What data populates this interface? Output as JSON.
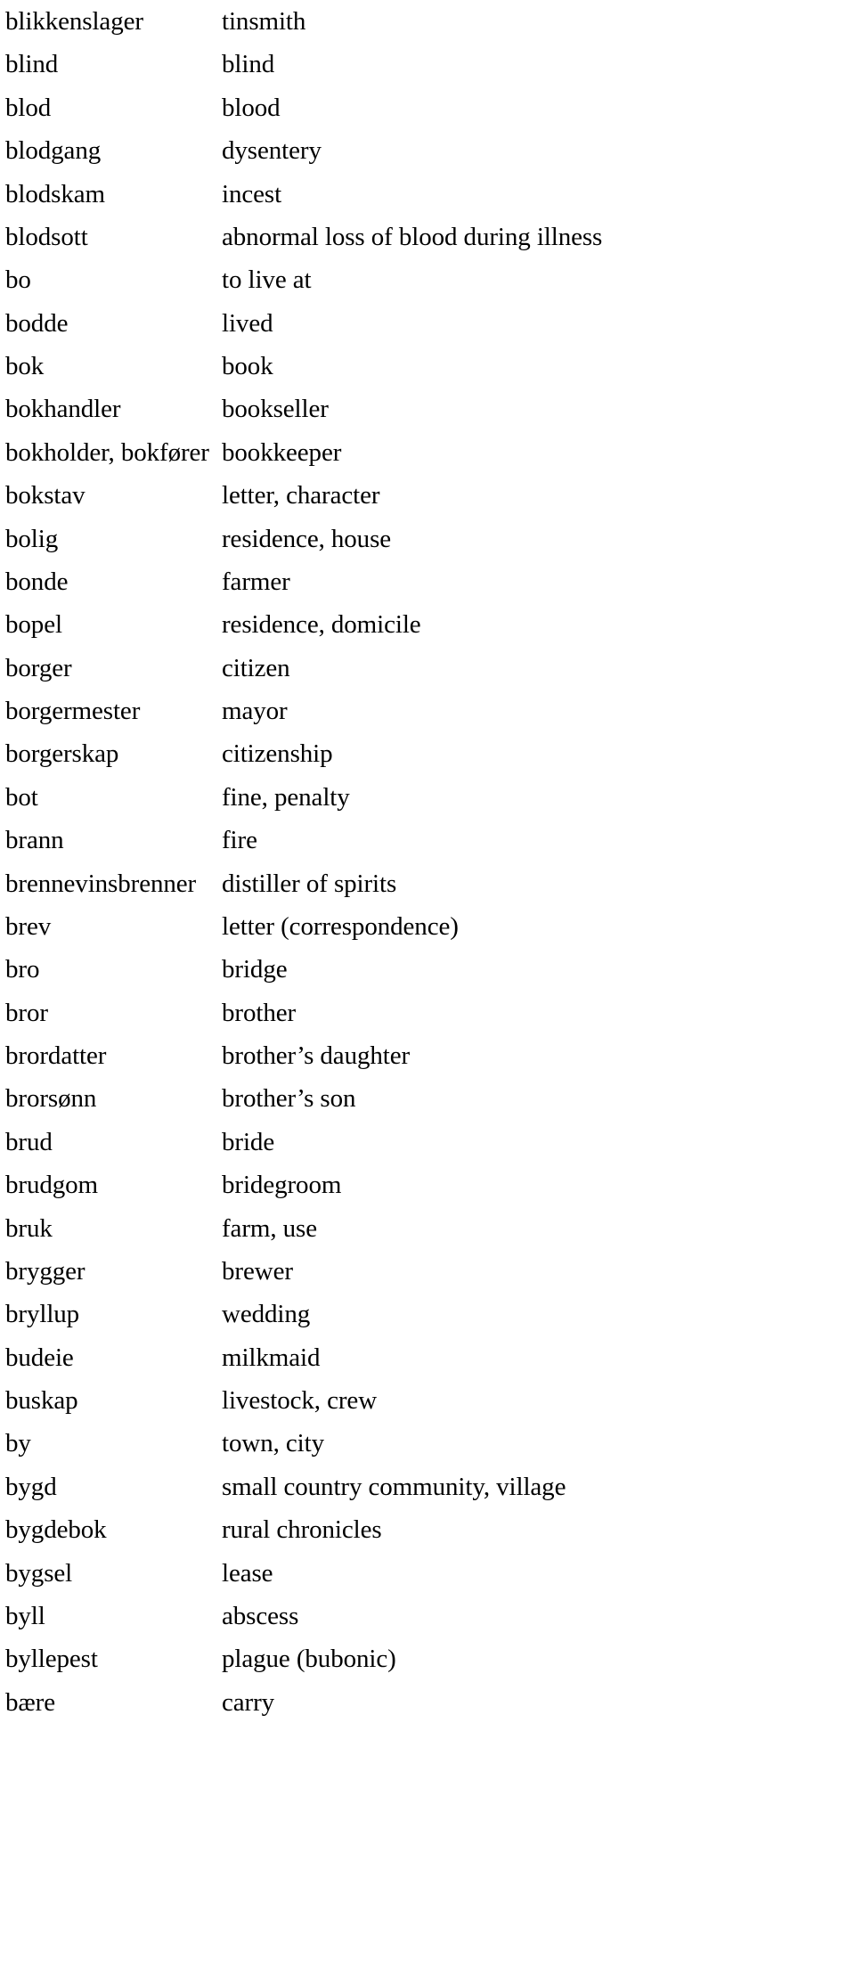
{
  "document": {
    "type": "glossary",
    "language_pair": "Norwegian to English",
    "columns": {
      "term_header": "",
      "definition_header": ""
    },
    "entries": [
      {
        "term": "blikkenslager",
        "definition": "tinsmith"
      },
      {
        "term": "blind",
        "definition": "blind"
      },
      {
        "term": "blod",
        "definition": "blood"
      },
      {
        "term": "blodgang",
        "definition": "dysentery"
      },
      {
        "term": "blodskam",
        "definition": "incest"
      },
      {
        "term": "blodsott",
        "definition": "abnormal loss of blood during illness"
      },
      {
        "term": "bo",
        "definition": "to live at"
      },
      {
        "term": "bodde",
        "definition": "lived"
      },
      {
        "term": "bok",
        "definition": "book"
      },
      {
        "term": "bokhandler",
        "definition": "bookseller"
      },
      {
        "term": "bokholder, bokfører",
        "definition": "bookkeeper"
      },
      {
        "term": "bokstav",
        "definition": "letter, character"
      },
      {
        "term": "bolig",
        "definition": "residence, house"
      },
      {
        "term": "bonde",
        "definition": "farmer"
      },
      {
        "term": "bopel",
        "definition": "residence, domicile"
      },
      {
        "term": "borger",
        "definition": "citizen"
      },
      {
        "term": "borgermester",
        "definition": "mayor"
      },
      {
        "term": "borgerskap",
        "definition": "citizenship"
      },
      {
        "term": "bot",
        "definition": "fine, penalty"
      },
      {
        "term": "brann",
        "definition": "fire"
      },
      {
        "term": "brennevinsbrenner",
        "definition": "distiller of spirits"
      },
      {
        "term": "brev",
        "definition": "letter (correspondence)"
      },
      {
        "term": "bro",
        "definition": "bridge"
      },
      {
        "term": "bror",
        "definition": "brother"
      },
      {
        "term": "brordatter",
        "definition": "brother’s daughter"
      },
      {
        "term": "brorsønn",
        "definition": "brother’s son"
      },
      {
        "term": "brud",
        "definition": "bride"
      },
      {
        "term": "brudgom",
        "definition": "bridegroom"
      },
      {
        "term": "bruk",
        "definition": "farm, use"
      },
      {
        "term": "brygger",
        "definition": "brewer"
      },
      {
        "term": "bryllup",
        "definition": "wedding"
      },
      {
        "term": "budeie",
        "definition": "milkmaid"
      },
      {
        "term": "buskap",
        "definition": "livestock, crew"
      },
      {
        "term": "by",
        "definition": "town, city"
      },
      {
        "term": "bygd",
        "definition": "small country community, village"
      },
      {
        "term": "bygdebok",
        "definition": "rural chronicles"
      },
      {
        "term": "bygsel",
        "definition": "lease"
      },
      {
        "term": "byll",
        "definition": "abscess"
      },
      {
        "term": "byllepest",
        "definition": "plague (bubonic)"
      },
      {
        "term": "bære",
        "definition": "carry"
      }
    ]
  }
}
